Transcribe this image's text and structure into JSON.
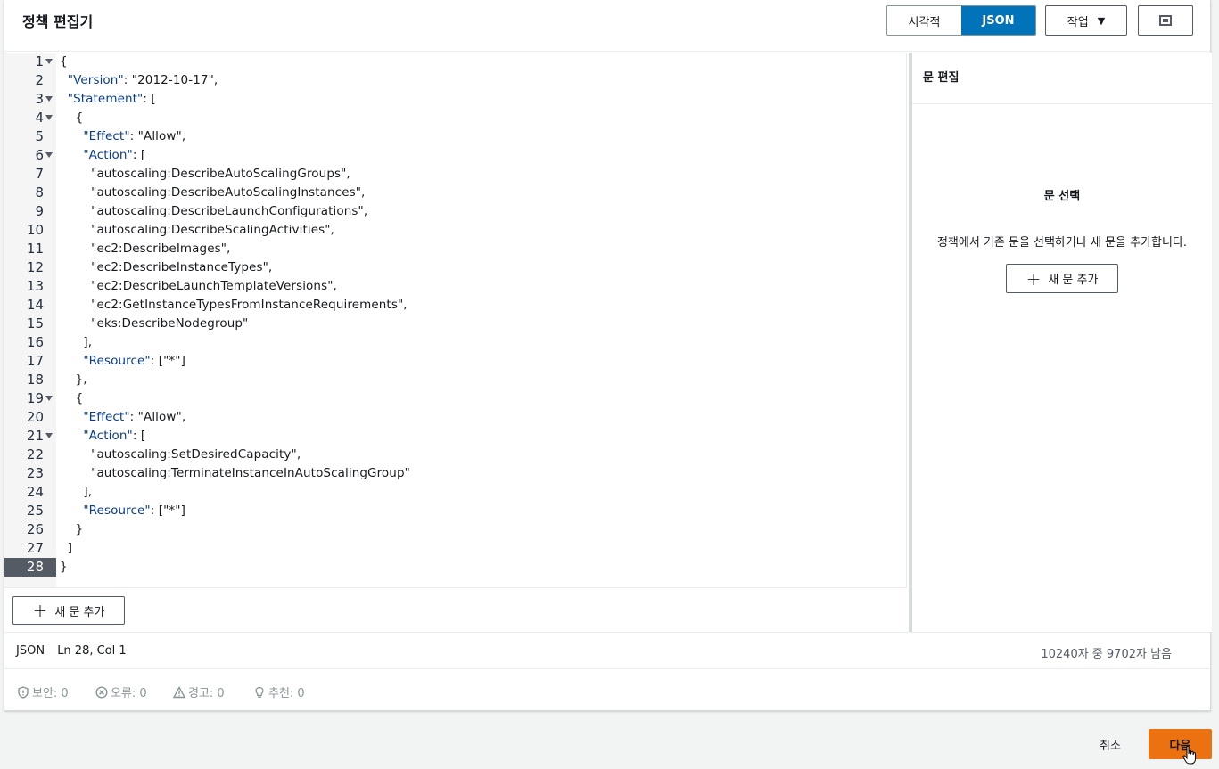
{
  "header": {
    "title": "정책 편집기",
    "visual_label": "시각적",
    "json_label": "JSON",
    "action_label": "작업"
  },
  "editor": {
    "lines": [
      "{",
      "  \"Version\": \"2012-10-17\",",
      "  \"Statement\": [",
      "    {",
      "      \"Effect\": \"Allow\",",
      "      \"Action\": [",
      "        \"autoscaling:DescribeAutoScalingGroups\",",
      "        \"autoscaling:DescribeAutoScalingInstances\",",
      "        \"autoscaling:DescribeLaunchConfigurations\",",
      "        \"autoscaling:DescribeScalingActivities\",",
      "        \"ec2:DescribeImages\",",
      "        \"ec2:DescribeInstanceTypes\",",
      "        \"ec2:DescribeLaunchTemplateVersions\",",
      "        \"ec2:GetInstanceTypesFromInstanceRequirements\",",
      "        \"eks:DescribeNodegroup\"",
      "      ],",
      "      \"Resource\": [\"*\"]",
      "    },",
      "    {",
      "      \"Effect\": \"Allow\",",
      "      \"Action\": [",
      "        \"autoscaling:SetDesiredCapacity\",",
      "        \"autoscaling:TerminateInstanceInAutoScalingGroup\"",
      "      ],",
      "      \"Resource\": [\"*\"]",
      "    }",
      "  ]",
      "}"
    ],
    "fold_lines": [
      1,
      3,
      4,
      6,
      19,
      21
    ],
    "active_line": 28,
    "add_statement_label": "새 문 추가"
  },
  "side": {
    "title": "문 편집",
    "heading": "문 선택",
    "desc": "정책에서 기존 문을 선택하거나 새 문을 추가합니다.",
    "add_label": "새 문 추가"
  },
  "status": {
    "mode": "JSON",
    "position": "Ln 28, Col 1",
    "chars": "10240자 중 9702자 남음"
  },
  "checks": {
    "security": "보안: 0",
    "errors": "오류: 0",
    "warnings": "경고: 0",
    "suggestions": "추천: 0"
  },
  "footer": {
    "cancel_label": "취소",
    "next_label": "다음"
  },
  "colors": {
    "primary": "#0073bb",
    "accent": "#ec7211"
  }
}
